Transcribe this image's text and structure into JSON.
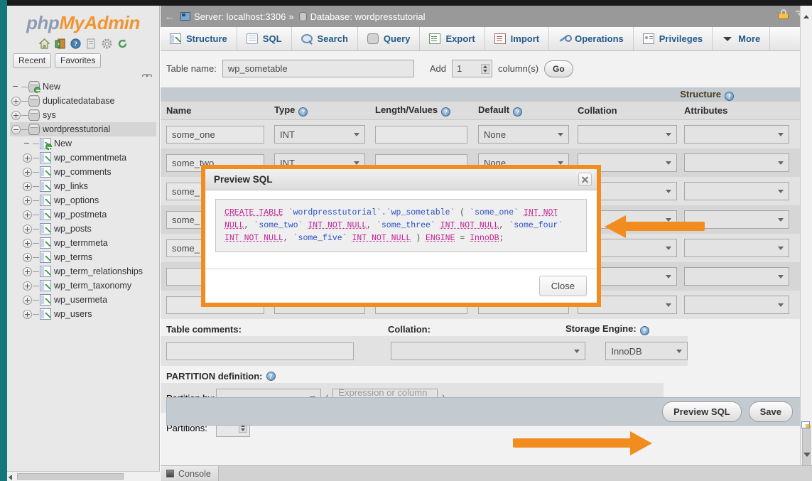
{
  "sidebar": {
    "brand": {
      "php": "php",
      "my": "My",
      "admin": "Admin"
    },
    "icons": [
      {
        "name": "home-icon",
        "label": "Home"
      },
      {
        "name": "logout-icon",
        "label": "Log out"
      },
      {
        "name": "help-icon",
        "label": "Help"
      },
      {
        "name": "docs-icon",
        "label": "Documentation"
      },
      {
        "name": "settings-icon",
        "label": "Settings"
      },
      {
        "name": "refresh-icon",
        "label": "Reload"
      }
    ],
    "recent_label": "Recent",
    "favorites_label": "Favorites",
    "tree": [
      {
        "label": "New",
        "level": 0,
        "toggle": "none",
        "icon": "db-new",
        "selected": false
      },
      {
        "label": "duplicatedatabase",
        "level": 0,
        "toggle": "plus",
        "icon": "db",
        "selected": false
      },
      {
        "label": "sys",
        "level": 0,
        "toggle": "plus",
        "icon": "db",
        "selected": false
      },
      {
        "label": "wordpresstutorial",
        "level": 0,
        "toggle": "minus",
        "icon": "db",
        "selected": true
      },
      {
        "label": "New",
        "level": 1,
        "toggle": "none",
        "icon": "tbl-new",
        "selected": false
      },
      {
        "label": "wp_commentmeta",
        "level": 1,
        "toggle": "plus",
        "icon": "tbl",
        "selected": false
      },
      {
        "label": "wp_comments",
        "level": 1,
        "toggle": "plus",
        "icon": "tbl",
        "selected": false
      },
      {
        "label": "wp_links",
        "level": 1,
        "toggle": "plus",
        "icon": "tbl",
        "selected": false
      },
      {
        "label": "wp_options",
        "level": 1,
        "toggle": "plus",
        "icon": "tbl",
        "selected": false
      },
      {
        "label": "wp_postmeta",
        "level": 1,
        "toggle": "plus",
        "icon": "tbl",
        "selected": false
      },
      {
        "label": "wp_posts",
        "level": 1,
        "toggle": "plus",
        "icon": "tbl",
        "selected": false
      },
      {
        "label": "wp_termmeta",
        "level": 1,
        "toggle": "plus",
        "icon": "tbl",
        "selected": false
      },
      {
        "label": "wp_terms",
        "level": 1,
        "toggle": "plus",
        "icon": "tbl",
        "selected": false
      },
      {
        "label": "wp_term_relationships",
        "level": 1,
        "toggle": "plus",
        "icon": "tbl",
        "selected": false
      },
      {
        "label": "wp_term_taxonomy",
        "level": 1,
        "toggle": "plus",
        "icon": "tbl",
        "selected": false
      },
      {
        "label": "wp_usermeta",
        "level": 1,
        "toggle": "plus",
        "icon": "tbl",
        "selected": false
      },
      {
        "label": "wp_users",
        "level": 1,
        "toggle": "plus",
        "icon": "tbl",
        "selected": false
      }
    ]
  },
  "header": {
    "back_arrow": "←",
    "server_label": "Server: localhost:3306",
    "separator": "»",
    "database_label": "Database: wordpresstutorial"
  },
  "tabs": [
    {
      "label": "Structure",
      "icon": "structure-icon"
    },
    {
      "label": "SQL",
      "icon": "sql-icon"
    },
    {
      "label": "Search",
      "icon": "search-icon"
    },
    {
      "label": "Query",
      "icon": "query-icon"
    },
    {
      "label": "Export",
      "icon": "export-icon"
    },
    {
      "label": "Import",
      "icon": "import-icon"
    },
    {
      "label": "Operations",
      "icon": "operations-icon"
    },
    {
      "label": "Privileges",
      "icon": "privileges-icon"
    },
    {
      "label": "More",
      "icon": "chevron-down-icon"
    }
  ],
  "form": {
    "table_name_label": "Table name:",
    "table_name_value": "wp_sometable",
    "add_label": "Add",
    "add_count": "1",
    "columns_label": "column(s)",
    "go_label": "Go",
    "structure_label": "Structure",
    "headers": [
      "Name",
      "Type",
      "Length/Values",
      "Default",
      "Collation",
      "Attributes"
    ],
    "rows": [
      {
        "name": "some_one",
        "type": "INT",
        "length": "",
        "default": "None",
        "collation": "",
        "attributes": ""
      },
      {
        "name": "some_two",
        "type": "INT",
        "length": "",
        "default": "None",
        "collation": "",
        "attributes": ""
      },
      {
        "name": "some_",
        "type": "",
        "length": "",
        "default": "",
        "collation": "",
        "attributes": ""
      },
      {
        "name": "some_",
        "type": "",
        "length": "",
        "default": "",
        "collation": "",
        "attributes": ""
      },
      {
        "name": "some_",
        "type": "",
        "length": "",
        "default": "",
        "collation": "",
        "attributes": ""
      },
      {
        "name": "",
        "type": "",
        "length": "",
        "default": "",
        "collation": "",
        "attributes": ""
      },
      {
        "name": "",
        "type": "",
        "length": "",
        "default": "",
        "collation": "",
        "attributes": ""
      }
    ],
    "table_comments_label": "Table comments:",
    "table_comments_value": "",
    "collation_label": "Collation:",
    "collation_value": "",
    "storage_engine_label": "Storage Engine:",
    "storage_engine_value": "InnoDB",
    "partition_definition_label": "PARTITION definition:",
    "partition_by_label": "Partition by:",
    "partition_by_value": "",
    "partition_open_paren": "(",
    "partition_expression_placeholder": "Expression or column list",
    "partition_close_paren": ")",
    "partitions_label": "Partitions:",
    "partitions_value": ""
  },
  "actions": {
    "preview_sql_label": "Preview SQL",
    "save_label": "Save"
  },
  "modal": {
    "title": "Preview SQL",
    "close_label": "Close",
    "sql": {
      "line1_kw1": "CREATE TABLE",
      "line1_id1": "`wordpresstutorial`.`wp_sometable`",
      "line1_paren": "(",
      "line1_id2": "`some_one`",
      "line1_kw2": "INT NOT",
      "line2_kw1": "NULL",
      "line2_sep1": ",",
      "line2_id1": "`some_two`",
      "line2_kw2": "INT NOT NULL",
      "line2_sep2": ",",
      "line2_id2": "`some_three`",
      "line2_kw3": "INT NOT NULL",
      "line2_sep3": ",",
      "line3_id1": "`some_four`",
      "line3_kw1": "INT NOT NULL",
      "line3_sep1": ",",
      "line3_id2": "`some_five`",
      "line3_kw2": "INT NOT NULL",
      "line3_paren": ")",
      "line3_kw3": "ENGINE",
      "line3_eq": "=",
      "line4_kw1": "InnoDB",
      "line4_semi": ";"
    },
    "full_sql": "CREATE TABLE `wordpresstutorial`.`wp_sometable` ( `some_one` INT NOT NULL , `some_two` INT NOT NULL , `some_three` INT NOT NULL , `some_four` INT NOT NULL , `some_five` INT NOT NULL ) ENGINE = InnoDB;"
  },
  "console": {
    "label": "Console"
  },
  "colors": {
    "annotation_orange": "#f28c1e",
    "brand_orange": "#f0952f",
    "brand_blue": "#8e9db5",
    "teal": "#157878",
    "tab_text": "#235a8c",
    "sql_keyword": "#c02090",
    "sql_identifier": "#2b50c8"
  }
}
